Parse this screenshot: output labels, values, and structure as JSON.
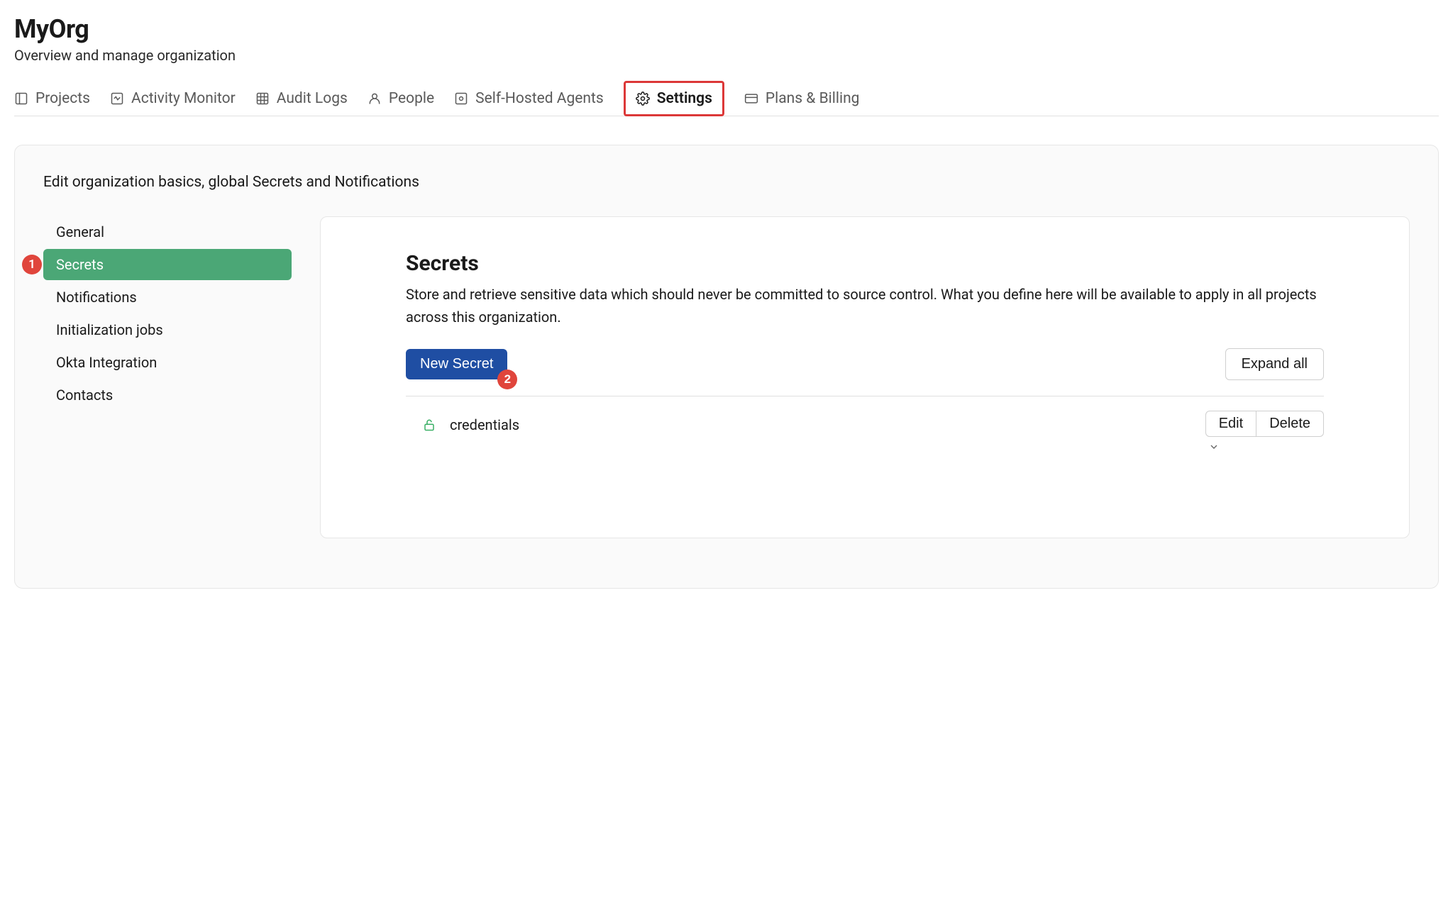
{
  "header": {
    "title": "MyOrg",
    "subtitle": "Overview and manage organization"
  },
  "tabs": {
    "projects": "Projects",
    "activity_monitor": "Activity Monitor",
    "audit_logs": "Audit Logs",
    "people": "People",
    "self_hosted_agents": "Self-Hosted Agents",
    "settings": "Settings",
    "plans_billing": "Plans & Billing"
  },
  "settings": {
    "intro": "Edit organization basics, global Secrets and Notifications",
    "sidebar": {
      "general": "General",
      "secrets": "Secrets",
      "notifications": "Notifications",
      "initialization_jobs": "Initialization jobs",
      "okta_integration": "Okta Integration",
      "contacts": "Contacts"
    },
    "callouts": {
      "secrets_badge": "1",
      "new_secret_badge": "2"
    },
    "content": {
      "title": "Secrets",
      "description": "Store and retrieve sensitive data which should never be committed to source control. What you define here will be available to apply in all projects across this organization.",
      "new_secret_button": "New Secret",
      "expand_all_button": "Expand all",
      "secret_item": {
        "name": "credentials",
        "edit": "Edit",
        "delete": "Delete"
      }
    }
  }
}
